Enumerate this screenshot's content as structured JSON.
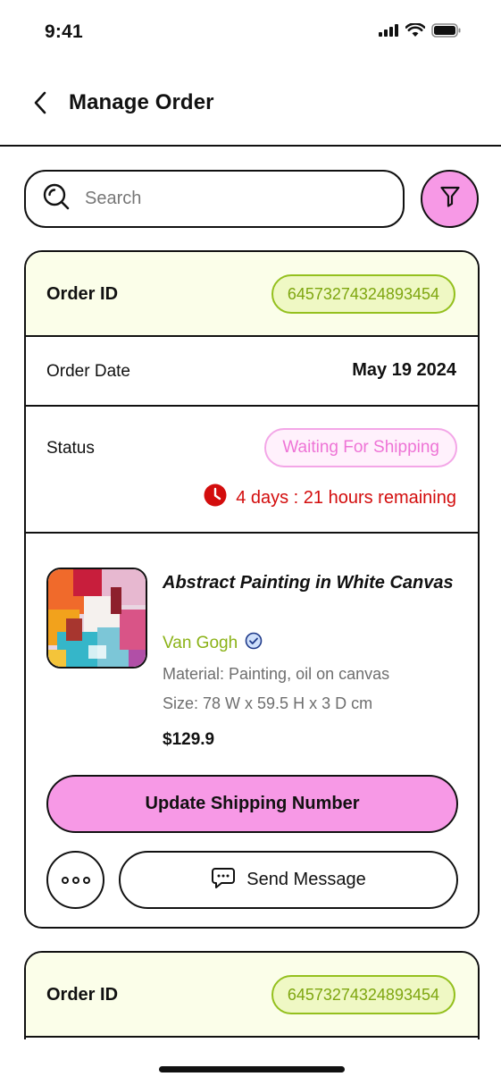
{
  "status_bar": {
    "time": "9:41",
    "icons": [
      "signal-icon",
      "wifi-icon",
      "battery-icon"
    ]
  },
  "nav": {
    "back_icon": "chevron-left-icon",
    "title": "Manage Order"
  },
  "search": {
    "placeholder": "Search",
    "value": "",
    "icon": "search-icon",
    "filter_icon": "filter-icon"
  },
  "orders": [
    {
      "id_label": "Order ID",
      "id_value": "64573274324893454",
      "date_label": "Order Date",
      "date_value": "May 19 2024",
      "status_label": "Status",
      "status_value": "Waiting For Shipping",
      "remaining": "4 days : 21 hours remaining",
      "product": {
        "title": "Abstract Painting in White Canvas",
        "artist": "Van Gogh",
        "material": "Material: Painting, oil on canvas",
        "size": "Size: 78 W x 59.5 H x 3 D cm",
        "price": "$129.9"
      },
      "primary_action": "Update Shipping Number",
      "secondary_action": "Send Message"
    },
    {
      "id_label": "Order ID",
      "id_value": "64573274324893454"
    }
  ],
  "colors": {
    "accent_pink": "#f799e6",
    "id_green": "#94c01e",
    "id_bg": "#fbfee9",
    "alert_red": "#d30d0d",
    "verified_blue": "#5b8fe0"
  }
}
